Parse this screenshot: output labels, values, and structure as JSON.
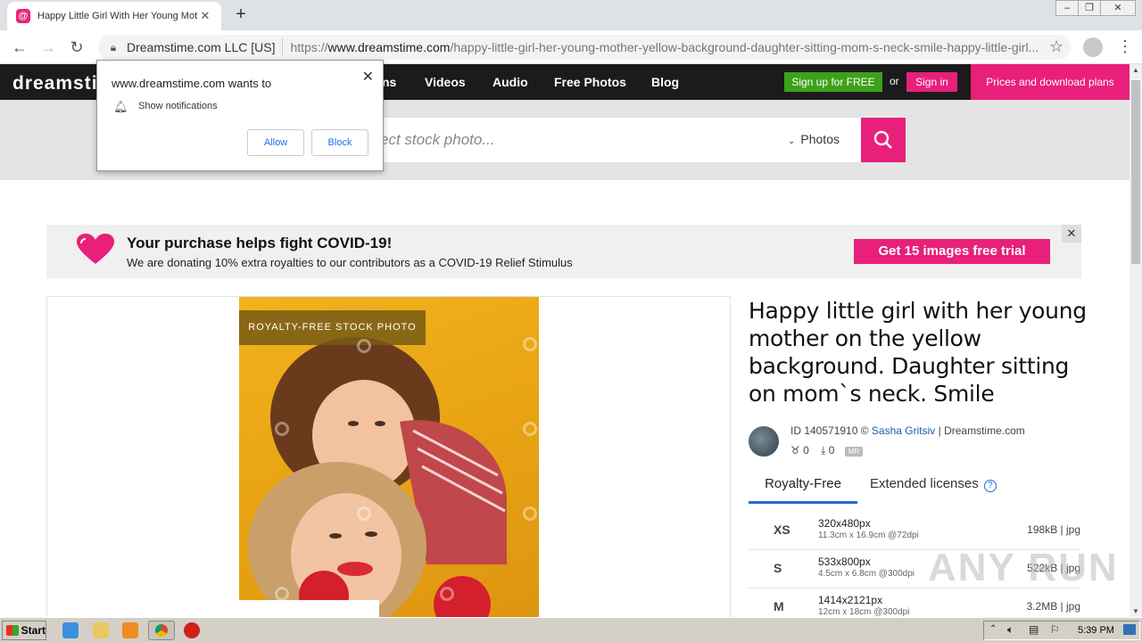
{
  "browser": {
    "tab_title": "Happy Little Girl With Her Young Mot",
    "tab_favicon": "dreamstime-favicon",
    "url_org": "Dreamstime.com LLC [US]",
    "url_scheme": "https://",
    "url_host": "www.dreamstime.com",
    "url_path": "/happy-little-girl-her-young-mother-yellow-background-daughter-sitting-mom-s-neck-smile-happy-little-girl..."
  },
  "notification": {
    "site_line": "www.dreamstime.com wants to",
    "permission": "Show notifications",
    "allow_label": "Allow",
    "block_label": "Block"
  },
  "header": {
    "logo": "dreamstime",
    "nav": [
      "ns",
      "Videos",
      "Audio",
      "Free Photos",
      "Blog"
    ],
    "signup_label": "Sign up for FREE",
    "or_label": "or",
    "signin_label": "Sign in",
    "prices_label": "Prices and download plans"
  },
  "search": {
    "placeholder": "ect stock photo...",
    "type_label": "Photos"
  },
  "covid": {
    "title": "Your purchase helps fight COVID-19!",
    "subtitle": "We are donating 10% extra royalties to our contributors as a COVID-19 Relief Stimulus",
    "trial_label": "Get 15 images free trial",
    "close_label": "✕"
  },
  "image": {
    "badge": "ROYALTY-FREE STOCK PHOTO"
  },
  "info": {
    "title": "Happy little girl with her young mother on the yellow background. Daughter sitting on mom`s neck. Smile",
    "id_prefix": "ID 140571910 ©",
    "author": "Sasha Gritsiv",
    "site_suffix": "| Dreamstime.com",
    "likes": "0",
    "downloads": "0",
    "mr_badge": "MR",
    "tab_royalty": "Royalty-Free",
    "tab_extended": "Extended licenses",
    "sizes": [
      {
        "code": "XS",
        "px": "320x480px",
        "cm": "11.3cm x 16.9cm @72dpi",
        "file": "198kB | jpg"
      },
      {
        "code": "S",
        "px": "533x800px",
        "cm": "4.5cm x 6.8cm @300dpi",
        "file": "522kB | jpg"
      },
      {
        "code": "M",
        "px": "1414x2121px",
        "cm": "12cm x 18cm @300dpi",
        "file": "3.2MB | jpg"
      }
    ]
  },
  "taskbar": {
    "start_label": "Start",
    "clock": "5:39 PM"
  },
  "watermark": "ANY RUN",
  "colors": {
    "brand_pink": "#e8207a",
    "signup_green": "#3ea11a",
    "header_dark": "#1b1b1b",
    "photo_yellow": "#f1b21e"
  }
}
